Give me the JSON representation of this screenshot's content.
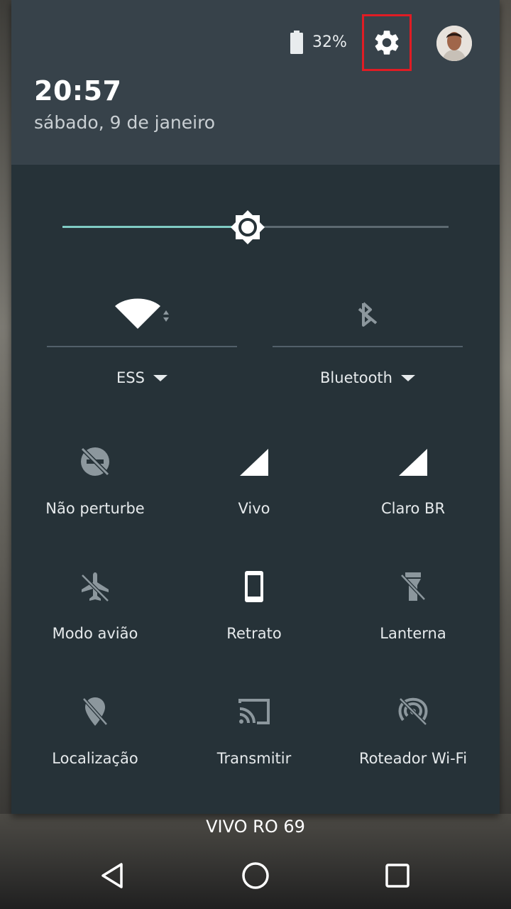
{
  "status": {
    "battery_percent_label": "32%",
    "battery_level": 0.32
  },
  "header": {
    "time": "20:57",
    "date": "sábado, 9 de janeiro"
  },
  "brightness": {
    "level": 0.48
  },
  "big_tiles": [
    {
      "label": "ESS",
      "icon": "wifi-icon",
      "state": "on"
    },
    {
      "label": "Bluetooth",
      "icon": "bluetooth-disabled-icon",
      "state": "off"
    }
  ],
  "tiles": [
    {
      "label": "Não perturbe",
      "icon": "do-not-disturb-off-icon"
    },
    {
      "label": "Vivo",
      "icon": "cell-signal-icon"
    },
    {
      "label": "Claro BR",
      "icon": "cell-signal-icon"
    },
    {
      "label": "Modo avião",
      "icon": "airplane-off-icon"
    },
    {
      "label": "Retrato",
      "icon": "portrait-icon"
    },
    {
      "label": "Lanterna",
      "icon": "flashlight-off-icon"
    },
    {
      "label": "Localização",
      "icon": "location-off-icon"
    },
    {
      "label": "Transmitir",
      "icon": "cast-icon"
    },
    {
      "label": "Roteador Wi-Fi",
      "icon": "hotspot-off-icon"
    }
  ],
  "carrier": "VIVO RO 69",
  "colors": {
    "panel": "#263238",
    "header": "#37424a",
    "accent": "#80cbc4",
    "highlight": "#e01c24"
  }
}
